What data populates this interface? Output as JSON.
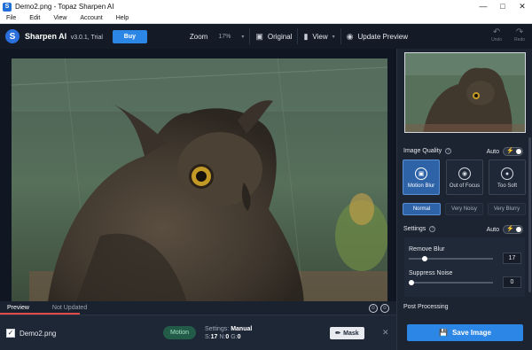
{
  "window": {
    "title": "Demo2.png - Topaz Sharpen AI",
    "minimize": "—",
    "maximize": "□",
    "close": "✕"
  },
  "menu": [
    "File",
    "Edit",
    "View",
    "Account",
    "Help"
  ],
  "toolbar": {
    "brand": "Sharpen AI",
    "version": "v3.0.1, Trial",
    "buy": "Buy",
    "zoom_label": "Zoom",
    "zoom_value": "17%",
    "original": "Original",
    "view": "View",
    "update_preview": "Update Preview",
    "undo": "Undo",
    "redo": "Redo"
  },
  "canvas": {
    "tab_preview": "Preview",
    "tab_status": "Not Updated"
  },
  "file": {
    "name": "Demo2.png",
    "mode": "Motion",
    "settings_label": "Settings:",
    "settings_value": "Manual",
    "s_label": "S:",
    "s_value": "17",
    "n_label": "N:",
    "n_value": "0",
    "g_label": "G:",
    "g_value": "0",
    "mask": "Mask",
    "remove": "✕"
  },
  "panel": {
    "image_quality": "Image Quality",
    "auto": "Auto",
    "modes": [
      "Motion Blur",
      "Out of Focus",
      "Too Soft"
    ],
    "variants": [
      "Normal",
      "Very Noisy",
      "Very Blurry"
    ],
    "settings": "Settings",
    "remove_blur": "Remove Blur",
    "remove_blur_value": "17",
    "remove_blur_level": 0.17,
    "suppress_noise": "Suppress Noise",
    "suppress_noise_value": "0",
    "suppress_noise_level": 0,
    "post_processing": "Post Processing",
    "save": "Save Image"
  },
  "colors": {
    "accent": "#2c86e6",
    "active_mode": "#2e63a8",
    "motion_pill": "#235b49",
    "tab_underline": "#e34b4b"
  }
}
